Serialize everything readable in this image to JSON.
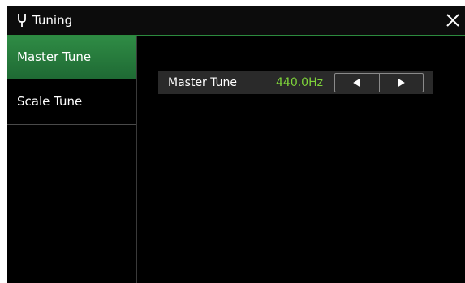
{
  "window": {
    "title": "Tuning",
    "icon": "tuning-fork-icon",
    "close_icon": "close-icon"
  },
  "sidebar": {
    "items": [
      {
        "label": "Master Tune",
        "active": true
      },
      {
        "label": "Scale Tune",
        "active": false
      }
    ]
  },
  "main": {
    "master_tune": {
      "label": "Master Tune",
      "value": "440.0Hz",
      "decrement_icon": "triangle-left-icon",
      "increment_icon": "triangle-right-icon"
    }
  },
  "colors": {
    "accent_green": "#2f8c45",
    "value_green": "#7ed33a",
    "background": "#000000",
    "row_background": "#2a2a2a"
  }
}
